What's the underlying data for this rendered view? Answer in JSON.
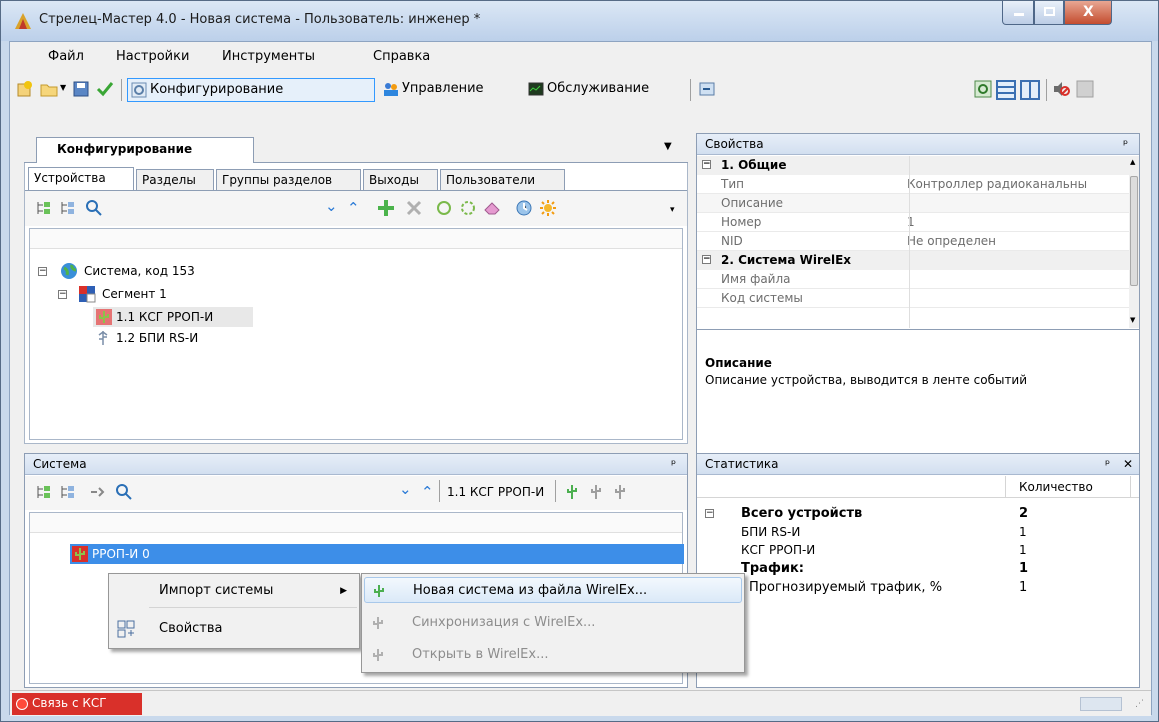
{
  "window": {
    "title": "Стрелец-Мастер 4.0 - Новая система - Пользователь: инженер *"
  },
  "menu": [
    "Файл",
    "Настройки",
    "Инструменты",
    "Справка"
  ],
  "toolbar": {
    "config": "Конфигурирование",
    "control": "Управление",
    "service": "Обслуживание"
  },
  "config_panel": {
    "title": "Конфигурирование",
    "tabs": [
      "Устройства",
      "Разделы",
      "Группы разделов",
      "Выходы",
      "Пользователи"
    ],
    "tree": {
      "system": "Система, код 153",
      "segment": "Сегмент 1",
      "dev1": "1.1 КСГ РРОП-И",
      "dev2": "1.2 БПИ RS-И"
    }
  },
  "properties": {
    "title": "Свойства",
    "cat1": "1. Общие",
    "rows1": [
      {
        "key": "Тип",
        "value": "Контроллер радиоканальны"
      },
      {
        "key": "Описание",
        "value": ""
      },
      {
        "key": "Номер",
        "value": "1"
      },
      {
        "key": "NID",
        "value": "Не определен"
      }
    ],
    "cat2": "2. Система WirelEx",
    "rows2": [
      {
        "key": "Имя файла",
        "value": ""
      },
      {
        "key": "Код системы",
        "value": ""
      }
    ],
    "desc_title": "Описание",
    "desc_text": "Описание устройства, выводится в ленте событий"
  },
  "system_panel": {
    "title": "Система",
    "device_label": "1.1 КСГ РРОП-И",
    "tree_item": "РРОП-И 0"
  },
  "context_menu": {
    "import": "Импорт системы",
    "props": "Свойства",
    "sub": [
      "Новая система из файла WirelEx...",
      "Синхронизация с WirelEx...",
      "Открыть в WirelEx..."
    ]
  },
  "stats": {
    "title": "Статистика",
    "col": "Количество",
    "total_label": "Всего устройств",
    "total_value": "2",
    "rows": [
      {
        "label": "БПИ RS-И",
        "value": "1"
      },
      {
        "label": "КСГ РРОП-И",
        "value": "1"
      }
    ],
    "traffic_label": "Трафик:",
    "traffic_value": "1",
    "forecast_label": "Прогнозируемый трафик, %",
    "forecast_value": "1"
  },
  "statusbar": {
    "link": "Связь с КСГ"
  },
  "colors": {
    "accent": "#3399ff",
    "status_red": "#d9302a",
    "selection": "#3d8ee8"
  }
}
